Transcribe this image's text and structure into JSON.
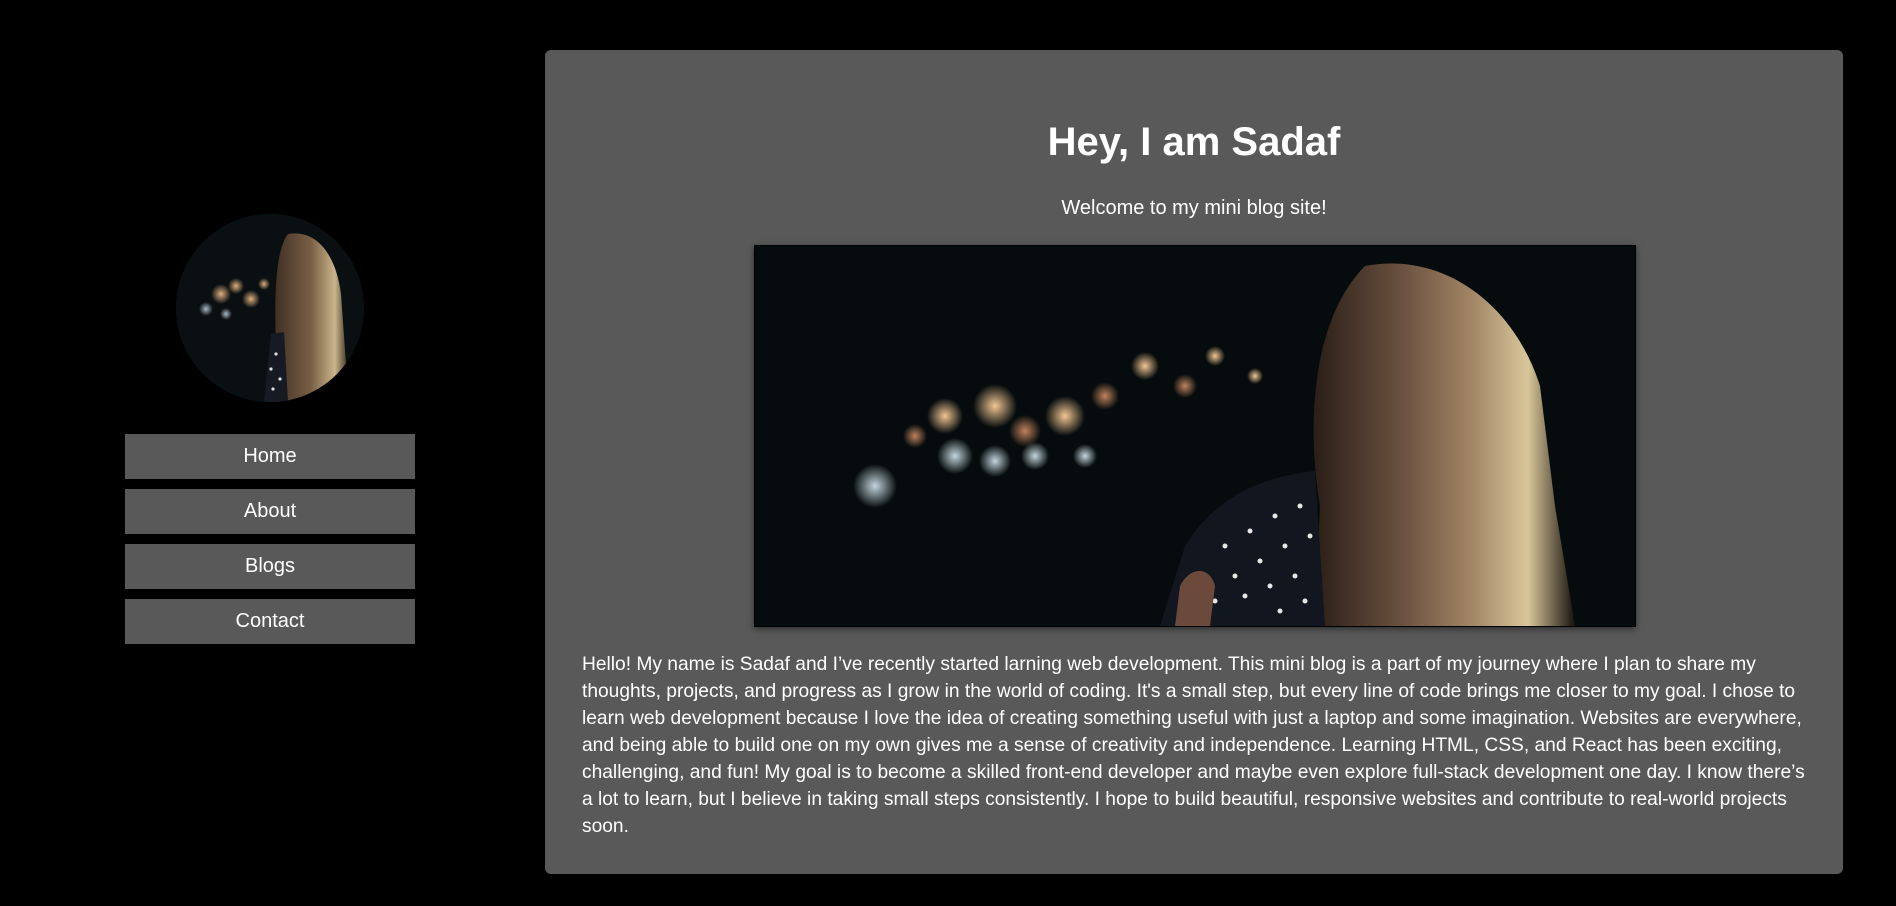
{
  "nav": {
    "items": [
      {
        "label": "Home"
      },
      {
        "label": "About"
      },
      {
        "label": "Blogs"
      },
      {
        "label": "Contact"
      }
    ]
  },
  "main": {
    "title": "Hey, I am Sadaf",
    "subtitle": "Welcome to my mini blog site!",
    "intro": "Hello! My name is Sadaf and I’ve recently started larning web development. This mini blog is a part of my journey where I plan to share my thoughts, projects, and progress as I grow in the world of coding. It's a small step, but every line of code brings me closer to my goal. I chose to learn web development because I love the idea of creating something useful with just a laptop and some imagination. Websites are everywhere, and being able to build one on my own gives me a sense of creativity and independence. Learning HTML, CSS, and React has been exciting, challenging, and fun! My goal is to become a skilled front-end developer and maybe even explore full-stack development one day. I know there’s a lot to learn, but I believe in taking small steps consistently. I hope to build beautiful, responsive websites and contribute to real-world projects soon."
  },
  "colors": {
    "page_background": "#000000",
    "panel_background": "#595959",
    "text": "#ffffff"
  }
}
